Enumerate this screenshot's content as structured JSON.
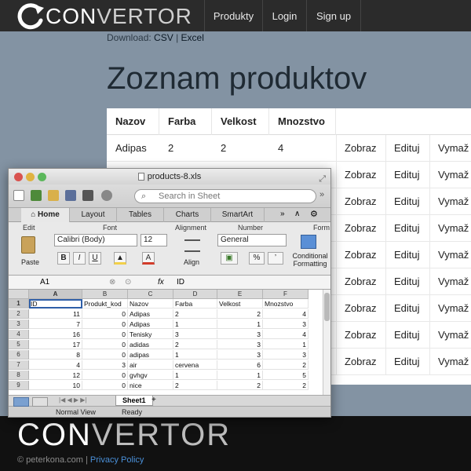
{
  "header": {
    "logo_text_a": "CON",
    "logo_text_b": "VERTOR",
    "nav": [
      "Produkty",
      "Login",
      "Sign up"
    ]
  },
  "download": {
    "label": "Download:",
    "csv": "CSV",
    "sep": "|",
    "excel": "Excel"
  },
  "page_title": "Zoznam produktov",
  "web_table": {
    "headers": [
      "Nazov",
      "Farba",
      "Velkost",
      "Mnozstvo"
    ],
    "rows": [
      [
        "Adipas",
        "2",
        "2",
        "4"
      ],
      [
        "",
        "",
        "",
        ""
      ],
      [
        "",
        "",
        "",
        ""
      ],
      [
        "",
        "",
        "",
        ""
      ],
      [
        "",
        "",
        "",
        ""
      ],
      [
        "",
        "",
        "",
        ""
      ],
      [
        "",
        "",
        "",
        ""
      ],
      [
        "",
        "",
        "",
        ""
      ],
      [
        "",
        "",
        "",
        ""
      ]
    ],
    "actions": [
      "Zobraz",
      "Edituj",
      "Vymaž"
    ]
  },
  "excel": {
    "title": "products-8.xls",
    "search_placeholder": "Search in Sheet",
    "tabs": [
      "Home",
      "Layout",
      "Tables",
      "Charts",
      "SmartArt"
    ],
    "ribbon_groups": [
      "Edit",
      "Font",
      "Alignment",
      "Number",
      "Form"
    ],
    "paste_label": "Paste",
    "font_name": "Calibri (Body)",
    "font_size": "12",
    "bold": "B",
    "italic": "I",
    "underline": "U",
    "align_label": "Align",
    "number_format": "General",
    "percent": "%",
    "comma": "’",
    "cond_format": "Conditional Formatting",
    "cell_ref": "A1",
    "fx": "fx",
    "formula_value": "ID",
    "columns": [
      "A",
      "B",
      "C",
      "D",
      "E",
      "F"
    ],
    "row_numbers": [
      "1",
      "2",
      "3",
      "4",
      "5",
      "6",
      "7",
      "8",
      "9"
    ],
    "cells": [
      [
        "ID",
        "Produkt_kod",
        "Nazov",
        "Farba",
        "Velkost",
        "Mnozstvo"
      ],
      [
        "11",
        "0",
        "Adipas",
        "2",
        "2",
        "4"
      ],
      [
        "7",
        "0",
        "Adipas",
        "1",
        "1",
        "3"
      ],
      [
        "16",
        "0",
        "Tenisky",
        "3",
        "3",
        "4"
      ],
      [
        "17",
        "0",
        "adidas",
        "2",
        "3",
        "1"
      ],
      [
        "8",
        "0",
        "adipas",
        "1",
        "3",
        "3"
      ],
      [
        "4",
        "3",
        "air",
        "cervena",
        "6",
        "2"
      ],
      [
        "12",
        "0",
        "gvhgv",
        "1",
        "1",
        "5"
      ],
      [
        "10",
        "0",
        "nice",
        "2",
        "2",
        "2"
      ]
    ],
    "sheet_tab": "Sheet1",
    "status_view": "Normal View",
    "status_ready": "Ready"
  },
  "footer": {
    "logo_a": "CON",
    "logo_b": "VERTOR",
    "credit": "© peterkona.com",
    "sep": "|",
    "privacy": "Privacy Policy"
  }
}
